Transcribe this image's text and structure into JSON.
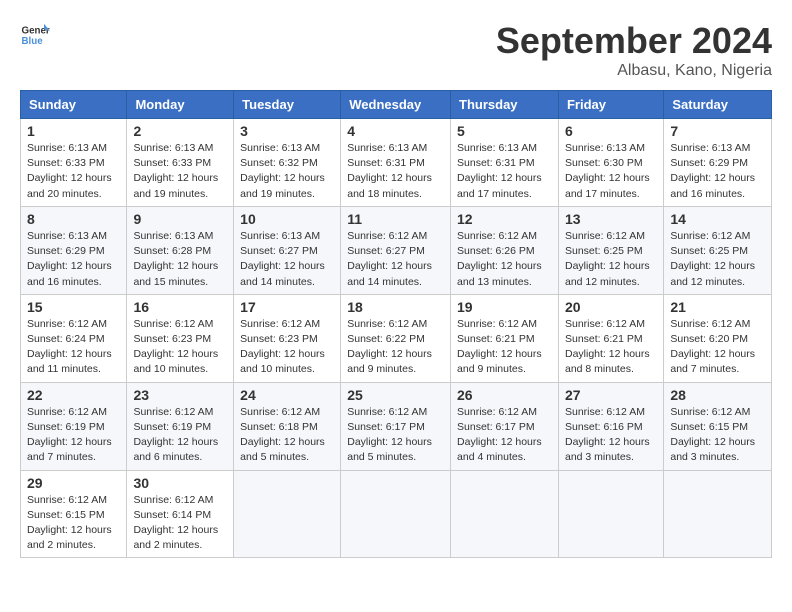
{
  "header": {
    "logo_general": "General",
    "logo_blue": "Blue",
    "month_title": "September 2024",
    "location": "Albasu, Kano, Nigeria"
  },
  "columns": [
    "Sunday",
    "Monday",
    "Tuesday",
    "Wednesday",
    "Thursday",
    "Friday",
    "Saturday"
  ],
  "weeks": [
    [
      {
        "day": "1",
        "sunrise": "6:13 AM",
        "sunset": "6:33 PM",
        "daylight": "12 hours and 20 minutes."
      },
      {
        "day": "2",
        "sunrise": "6:13 AM",
        "sunset": "6:33 PM",
        "daylight": "12 hours and 19 minutes."
      },
      {
        "day": "3",
        "sunrise": "6:13 AM",
        "sunset": "6:32 PM",
        "daylight": "12 hours and 19 minutes."
      },
      {
        "day": "4",
        "sunrise": "6:13 AM",
        "sunset": "6:31 PM",
        "daylight": "12 hours and 18 minutes."
      },
      {
        "day": "5",
        "sunrise": "6:13 AM",
        "sunset": "6:31 PM",
        "daylight": "12 hours and 17 minutes."
      },
      {
        "day": "6",
        "sunrise": "6:13 AM",
        "sunset": "6:30 PM",
        "daylight": "12 hours and 17 minutes."
      },
      {
        "day": "7",
        "sunrise": "6:13 AM",
        "sunset": "6:29 PM",
        "daylight": "12 hours and 16 minutes."
      }
    ],
    [
      {
        "day": "8",
        "sunrise": "6:13 AM",
        "sunset": "6:29 PM",
        "daylight": "12 hours and 16 minutes."
      },
      {
        "day": "9",
        "sunrise": "6:13 AM",
        "sunset": "6:28 PM",
        "daylight": "12 hours and 15 minutes."
      },
      {
        "day": "10",
        "sunrise": "6:13 AM",
        "sunset": "6:27 PM",
        "daylight": "12 hours and 14 minutes."
      },
      {
        "day": "11",
        "sunrise": "6:12 AM",
        "sunset": "6:27 PM",
        "daylight": "12 hours and 14 minutes."
      },
      {
        "day": "12",
        "sunrise": "6:12 AM",
        "sunset": "6:26 PM",
        "daylight": "12 hours and 13 minutes."
      },
      {
        "day": "13",
        "sunrise": "6:12 AM",
        "sunset": "6:25 PM",
        "daylight": "12 hours and 12 minutes."
      },
      {
        "day": "14",
        "sunrise": "6:12 AM",
        "sunset": "6:25 PM",
        "daylight": "12 hours and 12 minutes."
      }
    ],
    [
      {
        "day": "15",
        "sunrise": "6:12 AM",
        "sunset": "6:24 PM",
        "daylight": "12 hours and 11 minutes."
      },
      {
        "day": "16",
        "sunrise": "6:12 AM",
        "sunset": "6:23 PM",
        "daylight": "12 hours and 10 minutes."
      },
      {
        "day": "17",
        "sunrise": "6:12 AM",
        "sunset": "6:23 PM",
        "daylight": "12 hours and 10 minutes."
      },
      {
        "day": "18",
        "sunrise": "6:12 AM",
        "sunset": "6:22 PM",
        "daylight": "12 hours and 9 minutes."
      },
      {
        "day": "19",
        "sunrise": "6:12 AM",
        "sunset": "6:21 PM",
        "daylight": "12 hours and 9 minutes."
      },
      {
        "day": "20",
        "sunrise": "6:12 AM",
        "sunset": "6:21 PM",
        "daylight": "12 hours and 8 minutes."
      },
      {
        "day": "21",
        "sunrise": "6:12 AM",
        "sunset": "6:20 PM",
        "daylight": "12 hours and 7 minutes."
      }
    ],
    [
      {
        "day": "22",
        "sunrise": "6:12 AM",
        "sunset": "6:19 PM",
        "daylight": "12 hours and 7 minutes."
      },
      {
        "day": "23",
        "sunrise": "6:12 AM",
        "sunset": "6:19 PM",
        "daylight": "12 hours and 6 minutes."
      },
      {
        "day": "24",
        "sunrise": "6:12 AM",
        "sunset": "6:18 PM",
        "daylight": "12 hours and 5 minutes."
      },
      {
        "day": "25",
        "sunrise": "6:12 AM",
        "sunset": "6:17 PM",
        "daylight": "12 hours and 5 minutes."
      },
      {
        "day": "26",
        "sunrise": "6:12 AM",
        "sunset": "6:17 PM",
        "daylight": "12 hours and 4 minutes."
      },
      {
        "day": "27",
        "sunrise": "6:12 AM",
        "sunset": "6:16 PM",
        "daylight": "12 hours and 3 minutes."
      },
      {
        "day": "28",
        "sunrise": "6:12 AM",
        "sunset": "6:15 PM",
        "daylight": "12 hours and 3 minutes."
      }
    ],
    [
      {
        "day": "29",
        "sunrise": "6:12 AM",
        "sunset": "6:15 PM",
        "daylight": "12 hours and 2 minutes."
      },
      {
        "day": "30",
        "sunrise": "6:12 AM",
        "sunset": "6:14 PM",
        "daylight": "12 hours and 2 minutes."
      },
      null,
      null,
      null,
      null,
      null
    ]
  ]
}
